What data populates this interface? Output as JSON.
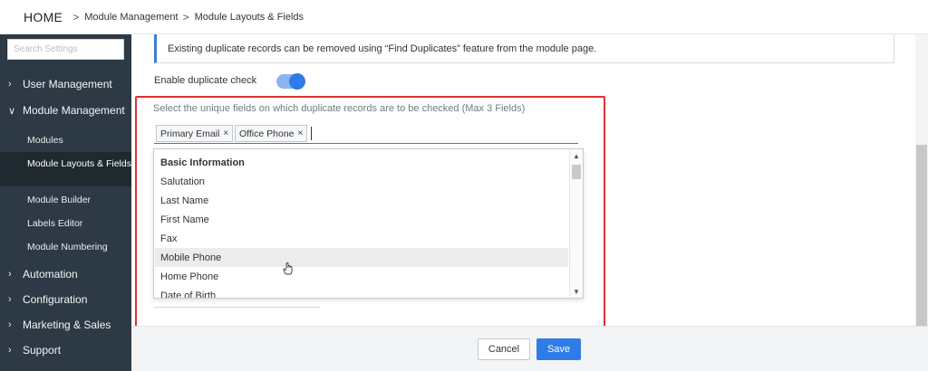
{
  "header": {
    "home": "HOME",
    "breadcrumbs": [
      "Module Management",
      "Module Layouts & Fields"
    ],
    "separator": ">"
  },
  "sidebar": {
    "search_placeholder": "Search Settings",
    "items": [
      {
        "label": "User Management",
        "chevron": ">"
      },
      {
        "label": "Module Management",
        "chevron": "v"
      },
      {
        "label": "Automation",
        "chevron": ">"
      },
      {
        "label": "Configuration",
        "chevron": ">"
      },
      {
        "label": "Marketing & Sales",
        "chevron": ">"
      },
      {
        "label": "Support",
        "chevron": ">"
      }
    ],
    "subitems": [
      {
        "label": "Modules"
      },
      {
        "label": "Module Layouts & Fields",
        "active": true
      },
      {
        "label": "Module Builder"
      },
      {
        "label": "Labels Editor"
      },
      {
        "label": "Module Numbering"
      }
    ]
  },
  "main": {
    "info_text": "Existing duplicate records can be removed using “Find Duplicates” feature from the module page.",
    "duplicate_check_label": "Enable duplicate check",
    "duplicate_check_enabled": true,
    "hint": "Select the unique fields on which duplicate records are to be checked (Max 3 Fields)",
    "selected_tags": [
      {
        "label": "Primary Email",
        "remove": "×"
      },
      {
        "label": "Office Phone",
        "remove": "×"
      }
    ],
    "dropdown": {
      "group": "Basic Information",
      "options": [
        "Salutation",
        "Last Name",
        "First Name",
        "Fax",
        "Mobile Phone",
        "Home Phone",
        "Date of Birth"
      ],
      "hovered": "Mobile Phone"
    }
  },
  "footer": {
    "cancel_label": "Cancel",
    "save_label": "Save"
  },
  "colors": {
    "sidebar_bg": "#2d3a45",
    "accent": "#2f7be8",
    "highlight": "#e03131"
  }
}
